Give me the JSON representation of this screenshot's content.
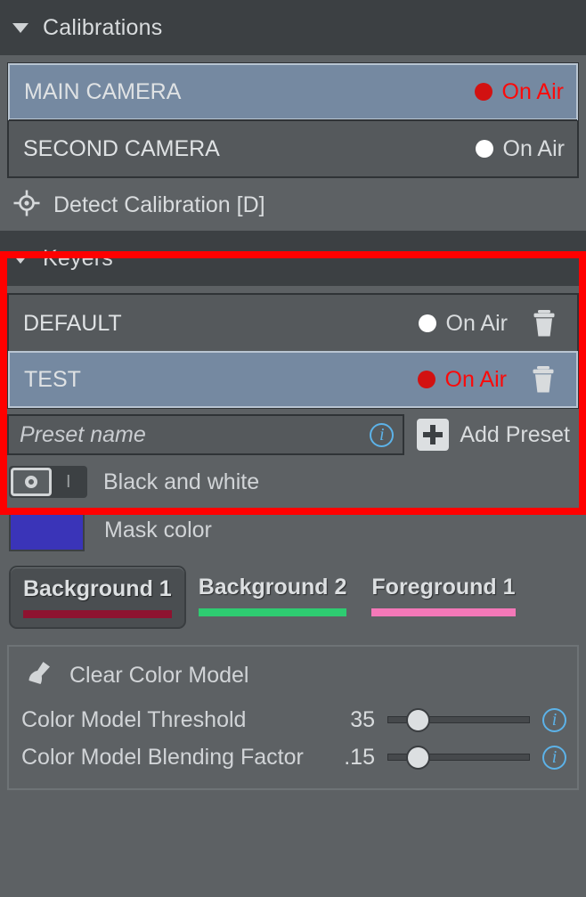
{
  "calibrations": {
    "title": "Calibrations",
    "collapse_icon": "triangle-down-icon",
    "items": [
      {
        "name": "MAIN CAMERA",
        "on_air_label": "On Air",
        "live": true,
        "selected": true
      },
      {
        "name": "SECOND CAMERA",
        "on_air_label": "On Air",
        "live": false,
        "selected": false
      }
    ],
    "detect_action": {
      "label": "Detect Calibration [D]",
      "icon": "crosshair-target-icon"
    }
  },
  "keyers": {
    "title": "Keyers",
    "collapse_icon": "triangle-down-icon",
    "highlighted": true,
    "highlight_color": "#ff0000",
    "items": [
      {
        "name": "DEFAULT",
        "on_air_label": "On Air",
        "live": false,
        "selected": false,
        "delete_icon": "trash-icon"
      },
      {
        "name": "TEST",
        "on_air_label": "On Air",
        "live": true,
        "selected": true,
        "delete_icon": "trash-icon"
      }
    ],
    "preset_input": {
      "value": "",
      "placeholder": "Preset name",
      "info_icon": "info-icon"
    },
    "add_preset": {
      "label": "Add Preset",
      "icon": "plus-icon"
    }
  },
  "options": {
    "black_and_white": {
      "label": "Black and white",
      "state": "off",
      "off_glyph": "O",
      "on_glyph": "I"
    },
    "mask_color": {
      "label": "Mask color",
      "color": "#3a34b8"
    }
  },
  "layer_tabs": [
    {
      "label": "Background 1",
      "color": "#8e1330",
      "active": true
    },
    {
      "label": "Background 2",
      "color": "#2ecc71",
      "active": false
    },
    {
      "label": "Foreground 1",
      "color": "#f478b8",
      "active": false
    }
  ],
  "color_model": {
    "clear_action": {
      "label": "Clear Color Model",
      "icon": "broom-icon"
    },
    "sliders": [
      {
        "label": "Color Model Threshold",
        "value": "35",
        "fraction": 0.16,
        "info_icon": "info-icon"
      },
      {
        "label": "Color Model Blending Factor",
        "value": ".15",
        "fraction": 0.16,
        "info_icon": "info-icon"
      }
    ]
  }
}
